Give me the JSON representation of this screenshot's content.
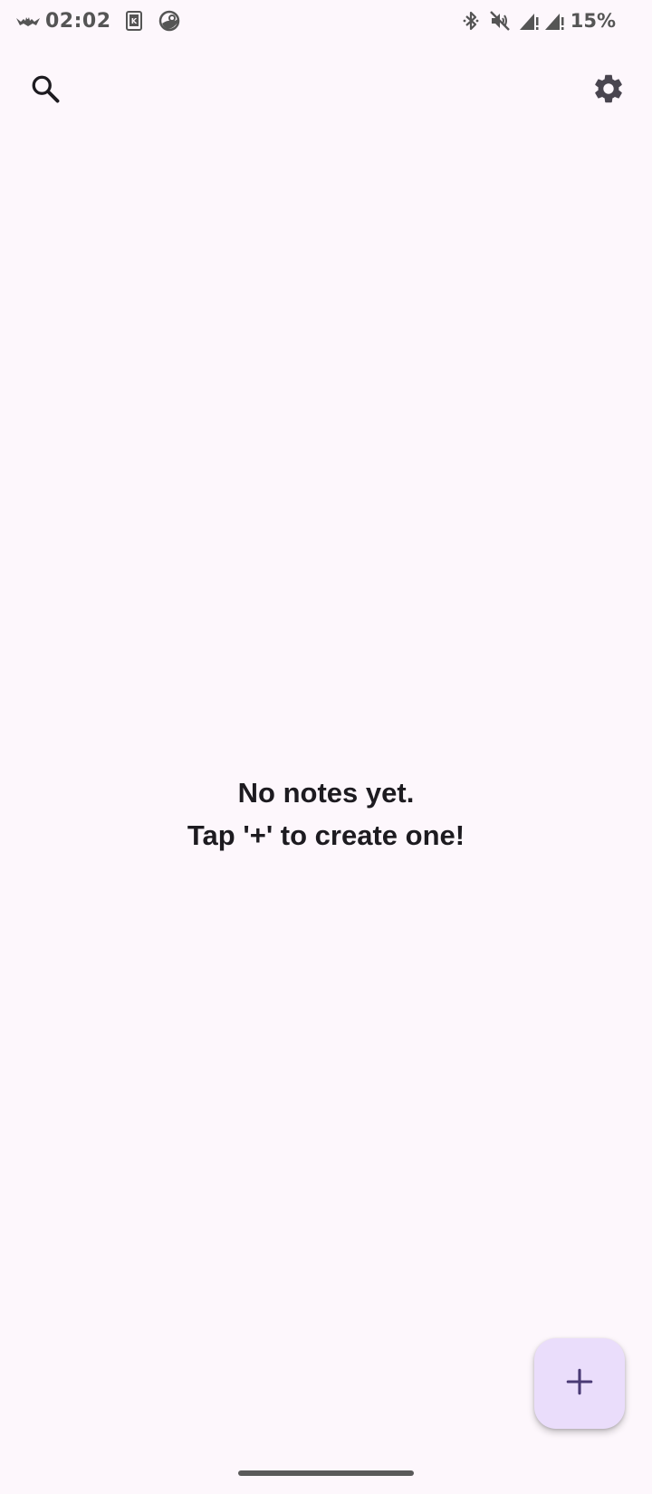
{
  "status_bar": {
    "time": "02:02",
    "battery": "15%",
    "left_icons": [
      "bat-icon",
      "kindle-app-icon",
      "steam-app-icon"
    ],
    "right_icons": [
      "bluetooth-icon",
      "mute-icon",
      "signal-icon",
      "signal-icon"
    ]
  },
  "top_bar": {
    "search_icon": "search-icon",
    "settings_icon": "gear-icon"
  },
  "empty_state": {
    "line1": "No notes yet.",
    "line2": "Tap '+' to create one!"
  },
  "fab": {
    "icon": "plus-icon",
    "color": "#eaddfb",
    "icon_color": "#4a3a74"
  },
  "colors": {
    "background": "#fdf7fc",
    "text": "#1d1b20"
  }
}
